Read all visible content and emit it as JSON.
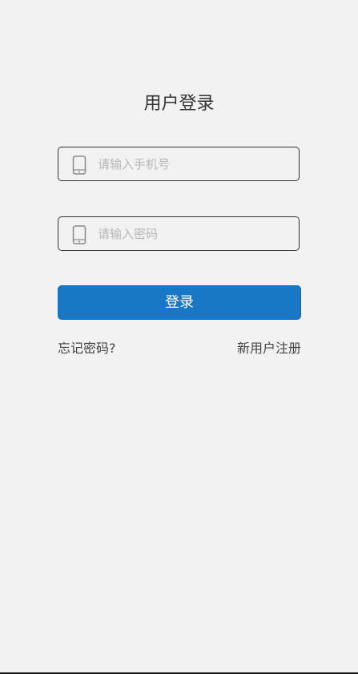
{
  "login": {
    "title": "用户登录",
    "phone_field": {
      "icon": "mobile-phone-icon",
      "placeholder": "请输入手机号",
      "value": ""
    },
    "password_field": {
      "icon": "mobile-phone-icon",
      "placeholder": "请输入密码",
      "value": ""
    },
    "submit_label": "登录",
    "forgot_password_label": "忘记密码?",
    "register_label": "新用户注册"
  },
  "colors": {
    "background": "#f2f2f2",
    "primary_button": "#1977c6",
    "field_border": "#333333",
    "placeholder": "#b6b6b6",
    "text": "#333333"
  }
}
